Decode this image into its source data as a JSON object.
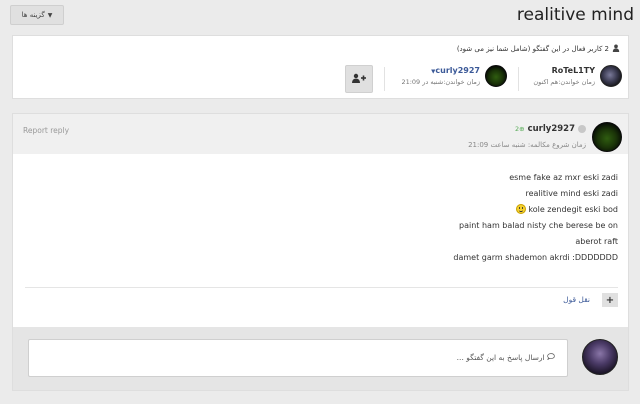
{
  "toolbar": {
    "options_label": "گزینه ها"
  },
  "thread": {
    "title": "realitive mind"
  },
  "participants": {
    "summary": "2 کاربر فعال در این گفتگو (شامل شما نیز می شود)",
    "users": [
      {
        "name": "RoTeL1TY",
        "seen": "زمان خواندن:هم اکنون"
      },
      {
        "name": "curly2927",
        "seen": "زمان خواندن:شنبه در 21:09"
      }
    ]
  },
  "message": {
    "report_label": "Report reply",
    "author": "curly2927",
    "reputation": "2",
    "started": "زمان شروع مکالمه: شنبه ساعت 21:09",
    "lines": [
      "esme fake az mxr eski zadi",
      "realitive mind eski zadi",
      "kole zendegit eski bod",
      "paint ham balad nisty che berese be on",
      "aberot raft",
      "damet garm shademon akrdi :DDDDDDD"
    ],
    "quote_label": "نقل قول"
  },
  "reply": {
    "placeholder": "ارسال پاسخ به این گفتگو ..."
  },
  "icons": {
    "caret": "caret-down-icon",
    "users": "users-icon",
    "add_user": "add-user-icon",
    "online": "status-dot-icon",
    "reputation": "plus-circle-icon",
    "smiley": "smiley-icon",
    "plus": "plus-icon",
    "comment": "comment-icon"
  },
  "colors": {
    "link": "#3b5998",
    "reputation": "#55aa55",
    "background": "#ebebeb"
  }
}
